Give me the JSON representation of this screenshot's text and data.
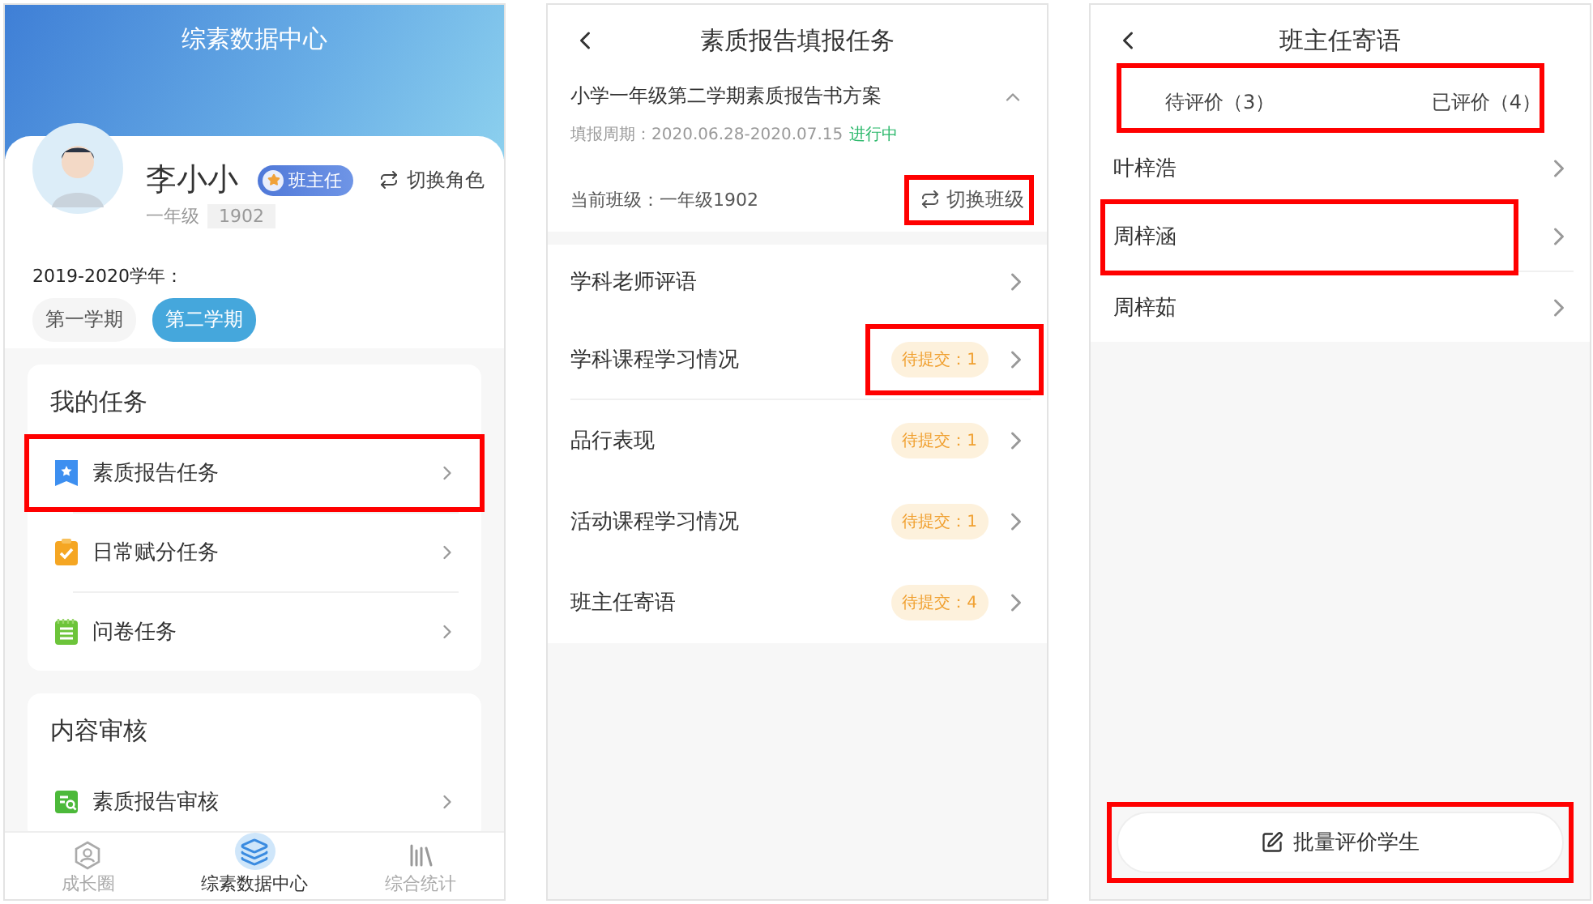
{
  "home": {
    "title": "综素数据中心",
    "user": {
      "name": "李小小",
      "role": "班主任",
      "switch_role": "切换角色",
      "grade": "一年级",
      "class": "1902"
    },
    "school_year": "2019-2020学年：",
    "terms": [
      {
        "label": "第一学期",
        "selected": false
      },
      {
        "label": "第二学期",
        "selected": true
      }
    ],
    "sections": [
      {
        "title": "我的任务",
        "items": [
          {
            "label": "素质报告任务",
            "highlighted": true
          },
          {
            "label": "日常赋分任务",
            "highlighted": false
          },
          {
            "label": "问卷任务",
            "highlighted": false
          }
        ]
      },
      {
        "title": "内容审核",
        "items": [
          {
            "label": "素质报告审核",
            "highlighted": false
          }
        ]
      }
    ],
    "nav": [
      {
        "label": "成长圈",
        "selected": false
      },
      {
        "label": "综素数据中心",
        "selected": true
      },
      {
        "label": "综合统计",
        "selected": false
      }
    ]
  },
  "report_task": {
    "title": "素质报告填报任务",
    "plan": {
      "name": "小学一年级第二学期素质报告书方案",
      "expanded": true,
      "period": "填报周期：2020.06.28-2020.07.15",
      "status": "进行中"
    },
    "current_class": "当前班级：一年级1902",
    "switch_class": {
      "label": "切换班级",
      "highlighted": true
    },
    "items": [
      {
        "label": "学科老师评语",
        "highlighted": false
      },
      {
        "label": "学科课程学习情况",
        "badge": "待提交：1",
        "highlighted": true
      },
      {
        "label": "品行表现",
        "badge": "待提交：1",
        "highlighted": false
      },
      {
        "label": "活动课程学习情况",
        "badge": "待提交：1",
        "highlighted": false
      },
      {
        "label": "班主任寄语",
        "badge": "待提交：4",
        "highlighted": false
      }
    ]
  },
  "comments": {
    "title": "班主任寄语",
    "tabs": [
      {
        "label": "待评价（3）"
      },
      {
        "label": "已评价（4）"
      }
    ],
    "tabs_highlighted": true,
    "students": [
      {
        "name": "叶梓浩",
        "highlighted": false
      },
      {
        "name": "周梓涵",
        "highlighted": true
      },
      {
        "name": "周梓茹",
        "highlighted": false
      }
    ],
    "batch_button": {
      "label": "批量评价学生",
      "highlighted": true
    }
  }
}
